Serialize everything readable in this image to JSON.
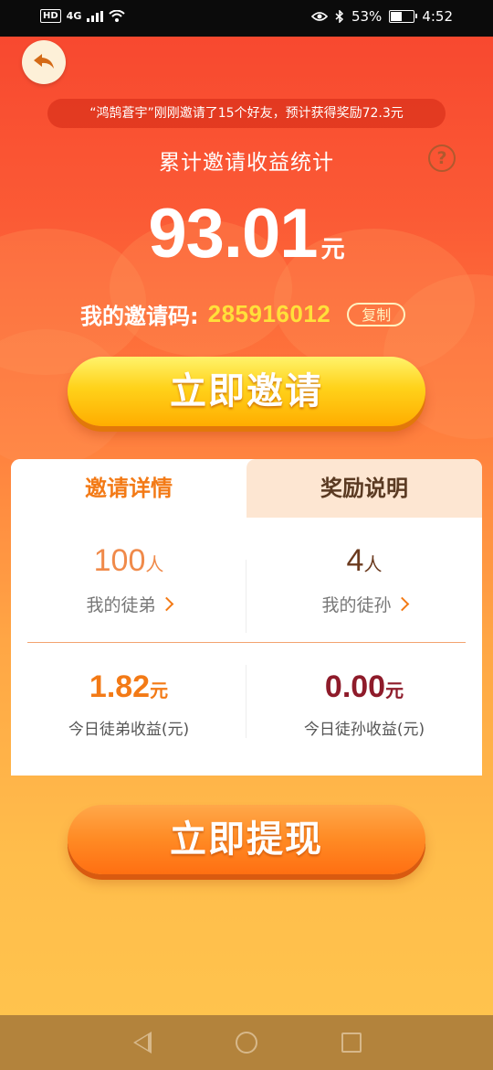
{
  "status_bar": {
    "hd": "HD",
    "network": "4G",
    "battery_percent": "53%",
    "battery_level": 0.53,
    "time": "4:52"
  },
  "ticker": "“鸿鹄蒼宇”刚刚邀请了15个好友，预计获得奖励72.3元",
  "stats": {
    "title": "累计邀请收益统计",
    "help_symbol": "?",
    "amount": "93.01",
    "amount_unit": "元"
  },
  "invite_code": {
    "label": "我的邀请码:",
    "code": "285916012",
    "copy_label": "复制"
  },
  "buttons": {
    "invite": "立即邀请",
    "withdraw": "立即提现"
  },
  "tabs": {
    "details": "邀请详情",
    "rules": "奖励说明"
  },
  "details": {
    "apprentice_count": "100",
    "apprentice_unit": "人",
    "apprentice_label": "我的徒弟",
    "grand_count": "4",
    "grand_unit": "人",
    "grand_label": "我的徒孙",
    "apprentice_income": "1.82",
    "apprentice_income_unit": "元",
    "apprentice_income_label": "今日徒弟收益(元)",
    "grand_income": "0.00",
    "grand_income_unit": "元",
    "grand_income_label": "今日徒孙收益(元)"
  },
  "colors": {
    "accent_orange": "#f37a16",
    "code_yellow": "#ffe03a",
    "dark_red": "#8e1b2a",
    "brown_text": "#6b3a1e"
  }
}
